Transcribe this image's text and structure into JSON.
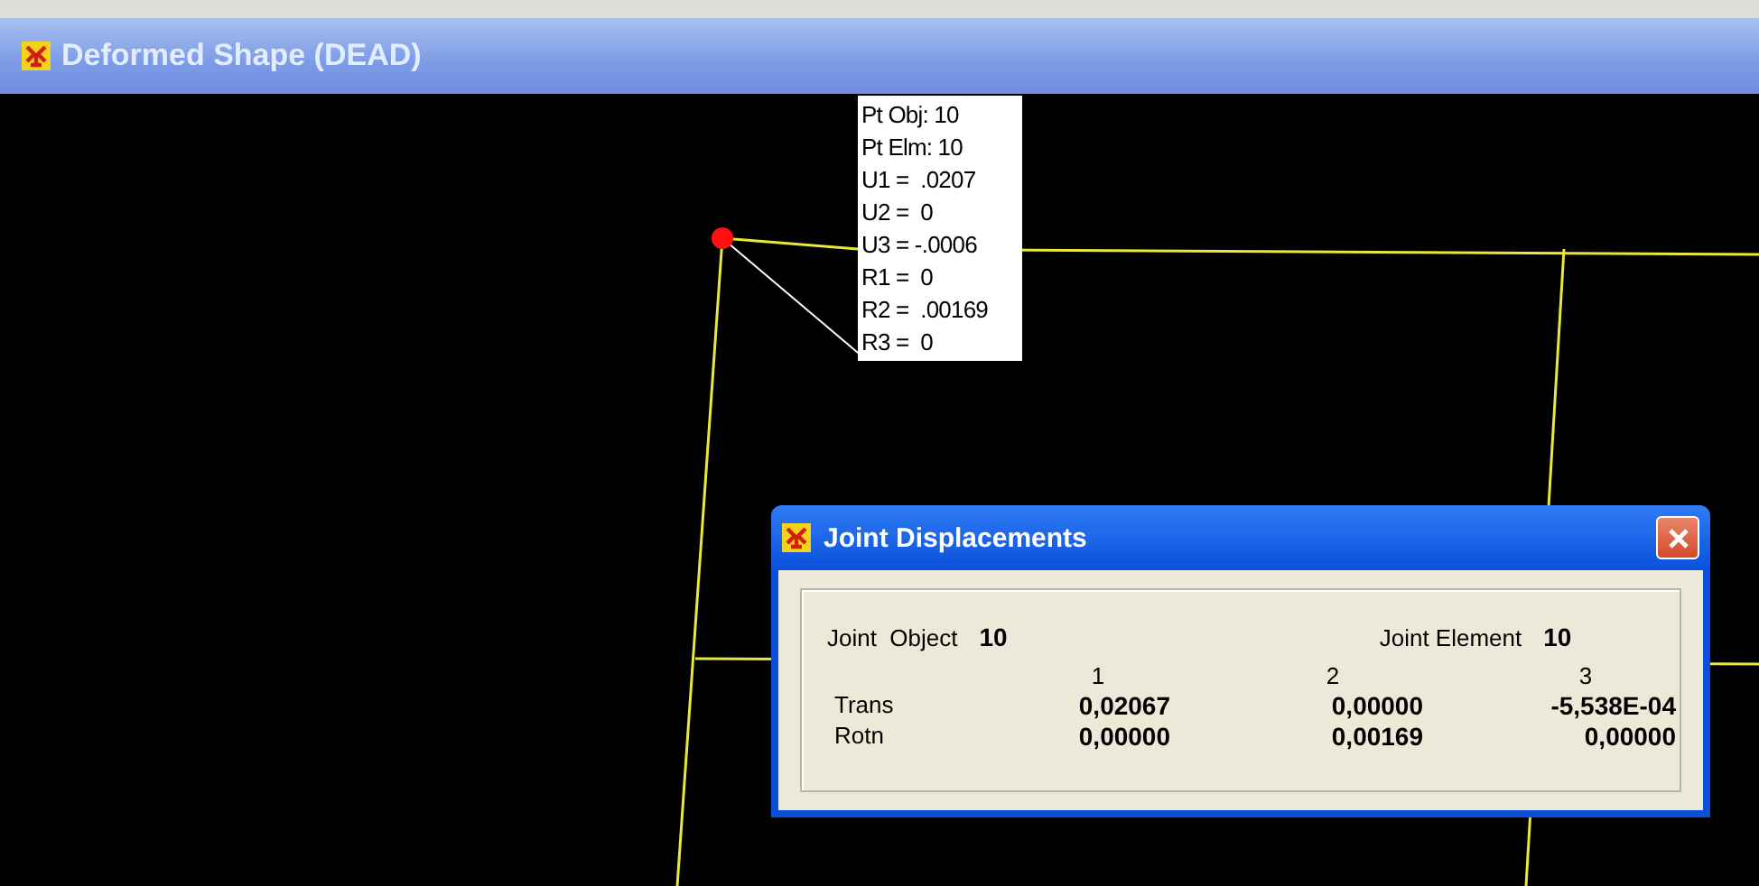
{
  "window": {
    "title": "Deformed Shape (DEAD)"
  },
  "tooltip": {
    "lines": [
      "Pt Obj: 10",
      "Pt Elm: 10",
      "U1 =  .0207",
      "U2 =  0",
      "U3 = -.0006",
      "R1 =  0",
      "R2 =  .00169",
      "R3 =  0"
    ]
  },
  "dialog": {
    "title": "Joint Displacements",
    "joint_object": {
      "label": "Joint  Object",
      "value": "10"
    },
    "joint_element": {
      "label": "Joint Element",
      "value": "10"
    },
    "columns": [
      "1",
      "2",
      "3"
    ],
    "rows": [
      {
        "label": "Trans",
        "values": [
          "0,02067",
          "0,00000",
          "-5,538E-04"
        ]
      },
      {
        "label": "Rotn",
        "values": [
          "0,00000",
          "0,00169",
          "0,00000"
        ]
      }
    ]
  }
}
